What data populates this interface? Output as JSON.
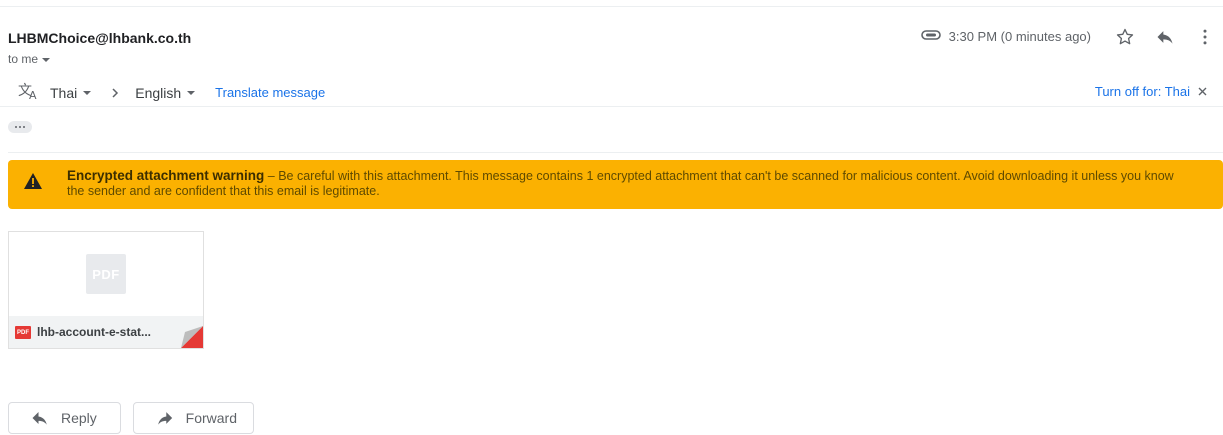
{
  "header": {
    "sender": "LHBMChoice@lhbank.co.th",
    "recipient": "to me",
    "timestamp": "3:30 PM (0 minutes ago)",
    "icons": [
      "attachment-icon",
      "star-icon",
      "reply-icon",
      "more-vert-icon"
    ]
  },
  "translate": {
    "source_lang": "Thai",
    "target_lang": "English",
    "translate_link": "Translate message",
    "turn_off": "Turn off for: Thai"
  },
  "warning": {
    "title": "Encrypted attachment warning",
    "message": " – Be careful with this attachment. This message contains 1 encrypted attachment that can't be scanned for malicious content. Avoid downloading it unless you know the sender and are confident that this email is legitimate.",
    "color": "#fbb101"
  },
  "attachment": {
    "preview_label": "PDF",
    "type_badge": "PDF",
    "filename": "lhb-account-e-stat..."
  },
  "actions": {
    "reply": "Reply",
    "forward": "Forward"
  },
  "colors": {
    "link": "#1a73e8",
    "pdf_red": "#e53935"
  }
}
